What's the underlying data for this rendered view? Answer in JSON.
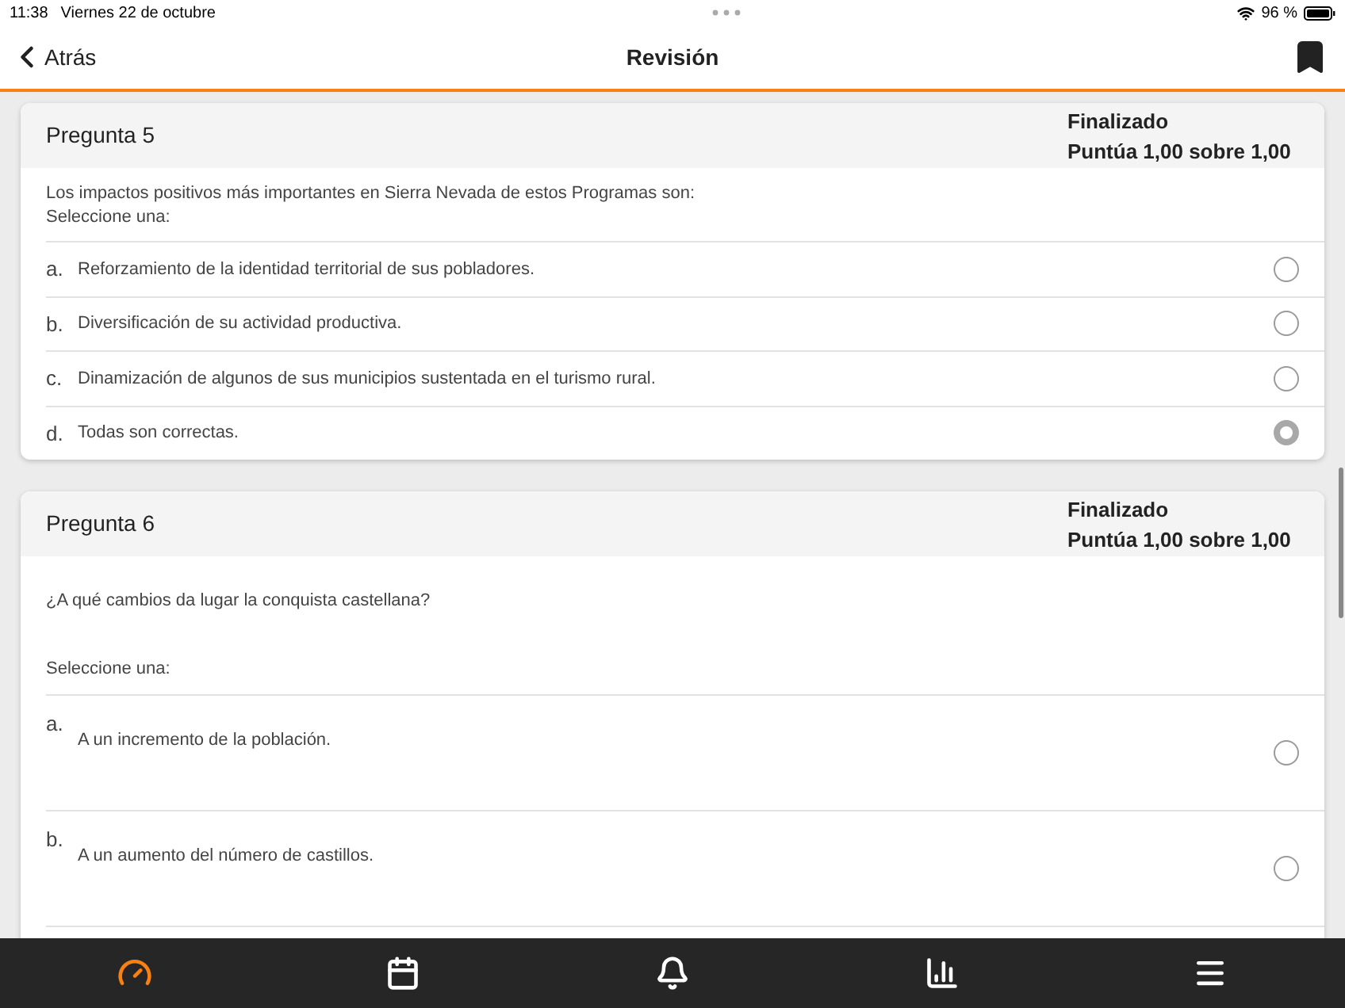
{
  "status_bar": {
    "time": "11:38",
    "date": "Viernes 22 de octubre",
    "battery": "96 %"
  },
  "nav": {
    "back": "Atrás",
    "title": "Revisión"
  },
  "questions": [
    {
      "kind": "compact",
      "title": "Pregunta 5",
      "state": "Finalizado",
      "grade": "Puntúa 1,00 sobre 1,00",
      "text": "Los impactos positivos más importantes en Sierra Nevada de estos Programas son:",
      "prompt": "Seleccione una:",
      "options": [
        {
          "letter": "a.",
          "text": "Reforzamiento de la identidad territorial de sus pobladores.",
          "selected": false
        },
        {
          "letter": "b.",
          "text": "Diversificación de su actividad productiva.",
          "selected": false
        },
        {
          "letter": "c.",
          "text": "Dinamización de algunos de sus municipios sustentada en el turismo rural.",
          "selected": false
        },
        {
          "letter": "d.",
          "text": "Todas son correctas.",
          "selected": true
        }
      ]
    },
    {
      "kind": "spaced",
      "title": "Pregunta 6",
      "state": "Finalizado",
      "grade": "Puntúa 1,00 sobre 1,00",
      "text": "¿A qué cambios da lugar la conquista castellana?",
      "prompt": "Seleccione una:",
      "options": [
        {
          "letter": "a.",
          "text": "A un incremento de la población.",
          "selected": false
        },
        {
          "letter": "b.",
          "text": "A un aumento del número de castillos.",
          "selected": false
        }
      ]
    }
  ],
  "tab_bar": [
    {
      "kind": "dashboard",
      "selected": true
    },
    {
      "kind": "calendar",
      "selected": false
    },
    {
      "kind": "notifications",
      "selected": false
    },
    {
      "kind": "grades",
      "selected": false
    },
    {
      "kind": "menu",
      "selected": false
    }
  ]
}
